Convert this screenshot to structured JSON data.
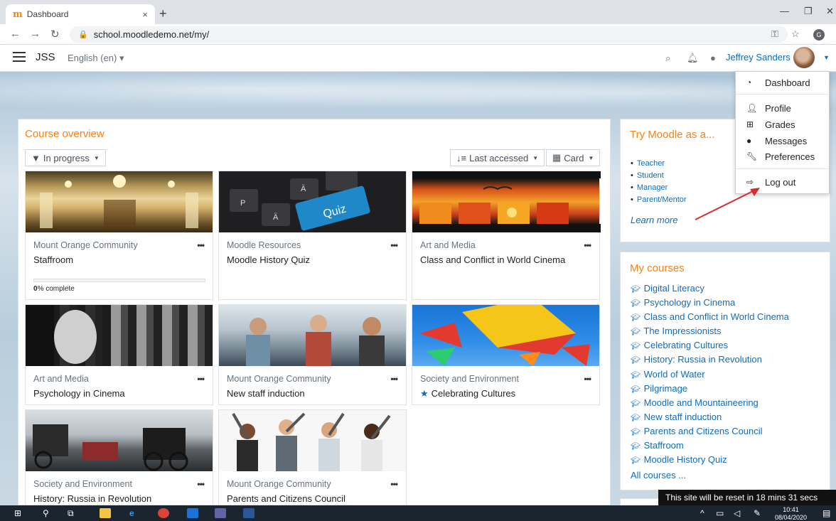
{
  "browser": {
    "tab_title": "Dashboard",
    "tab_close": "×",
    "new_tab": "+",
    "url": "school.moodledemo.net/my/",
    "profile_initial": "G",
    "minimize": "—",
    "restore": "❐",
    "close": "✕"
  },
  "navbar": {
    "site_name": "JSS",
    "language": "English (en) ▾",
    "user_name": "Jeffrey Sanders"
  },
  "course_overview": {
    "title": "Course overview",
    "filter_label": "In progress",
    "sort_label": "Last accessed",
    "view_label": "Card",
    "courses": [
      {
        "category": "Mount Orange Community",
        "name": "Staffroom",
        "progress_label": "0",
        "progress_suffix": "% complete",
        "progress": 0
      },
      {
        "category": "Moodle Resources",
        "name": "Moodle History Quiz"
      },
      {
        "category": "Art and Media",
        "name": "Class and Conflict in World Cinema"
      },
      {
        "category": "Art and Media",
        "name": "Psychology in Cinema"
      },
      {
        "category": "Mount Orange Community",
        "name": "New staff induction"
      },
      {
        "category": "Society and Environment",
        "name": "Celebrating Cultures",
        "starred": true
      },
      {
        "category": "Society and Environment",
        "name": "History: Russia in Revolution"
      },
      {
        "category": "Mount Orange Community",
        "name": "Parents and Citizens Council"
      }
    ],
    "quiz_keyword": "Quiz"
  },
  "try_moodle": {
    "title": "Try Moodle as a...",
    "roles": [
      "Teacher",
      "Student",
      "Manager",
      "Parent/Mentor"
    ],
    "learn_more": "Learn more"
  },
  "my_courses": {
    "title": "My courses",
    "items": [
      "Digital Literacy",
      "Psychology in Cinema",
      "Class and Conflict in World Cinema",
      "The Impressionists",
      "Celebrating Cultures",
      "History: Russia in Revolution",
      "World of Water",
      "Pilgrimage",
      "Moodle and Mountaineering",
      "New staff induction",
      "Parents and Citizens Council",
      "Staffroom",
      "Moodle History Quiz"
    ],
    "all_courses": "All courses ..."
  },
  "user_menu": {
    "items": [
      "Dashboard",
      "Profile",
      "Grades",
      "Messages",
      "Preferences",
      "Log out"
    ]
  },
  "reset_notice": "This site will be reset in 18 mins 31 secs",
  "taskbar": {
    "time": "10:41",
    "date": "08/04/2020"
  },
  "colors": {
    "accent_orange": "#f98012",
    "link_blue": "#0f6cbf",
    "annotation_arrow": "#d32f2f"
  }
}
